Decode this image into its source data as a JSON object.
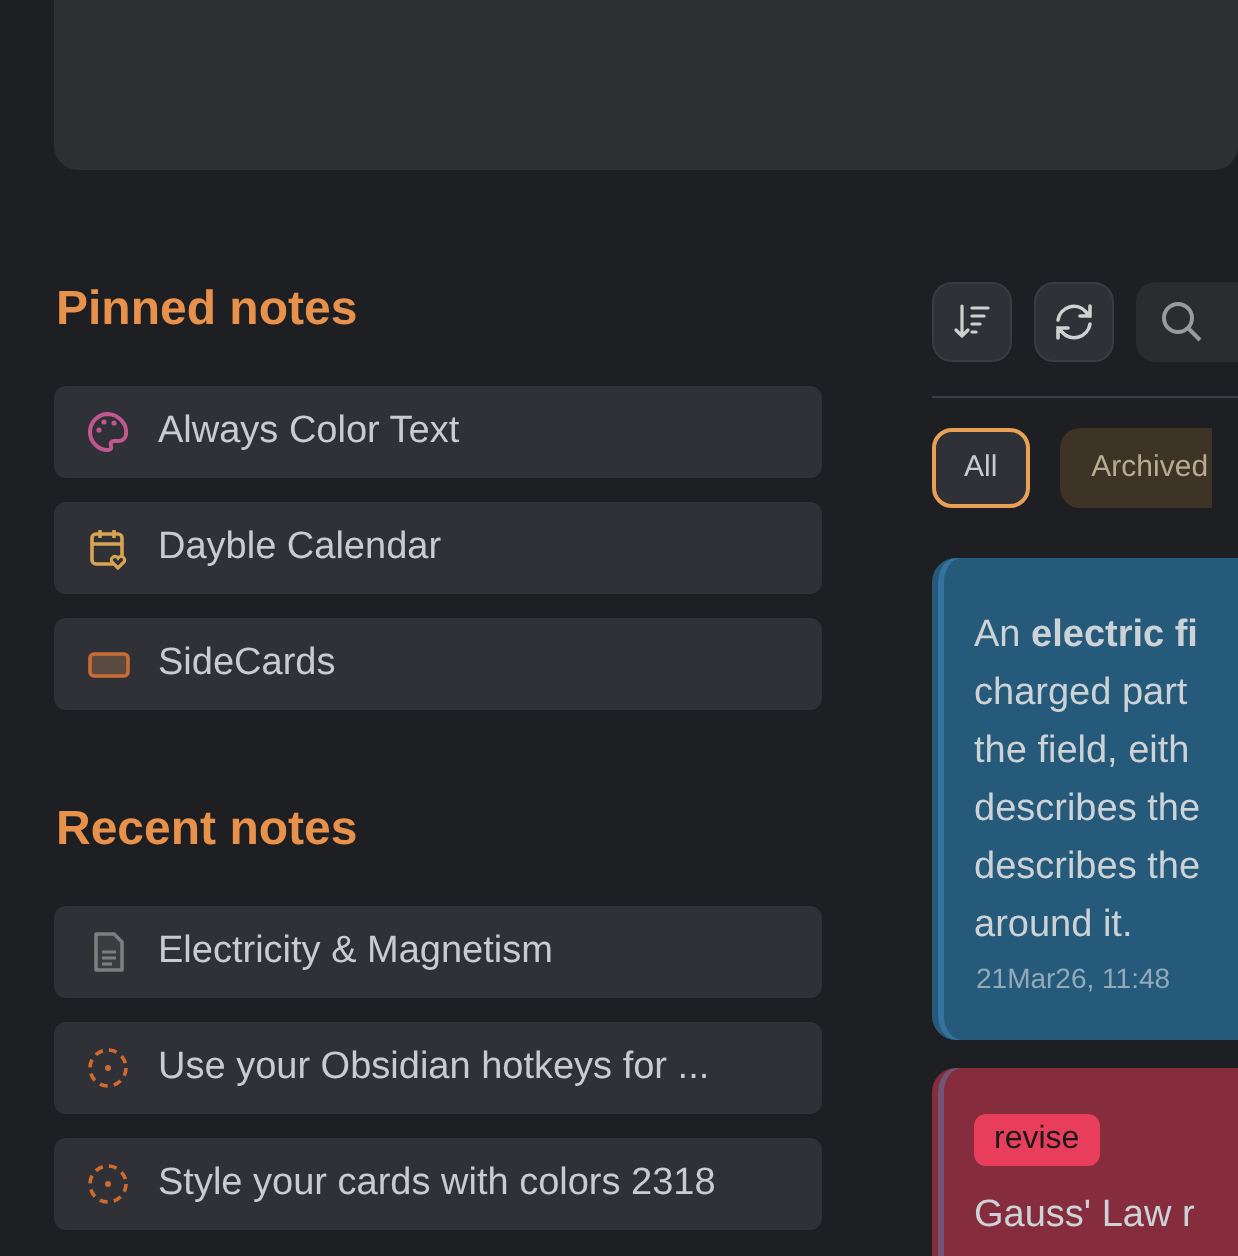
{
  "pinned": {
    "title": "Pinned notes",
    "items": [
      {
        "label": "Always Color Text",
        "kind": "palette"
      },
      {
        "label": "Dayble Calendar",
        "kind": "calendar"
      },
      {
        "label": "SideCards",
        "kind": "card"
      }
    ]
  },
  "recent": {
    "title": "Recent notes",
    "items": [
      {
        "label": "Electricity & Magnetism",
        "kind": "file"
      },
      {
        "label": "Use your Obsidian hotkeys for ...",
        "kind": "draft"
      },
      {
        "label": "Style your cards with colors 2318",
        "kind": "draft"
      }
    ]
  },
  "filters": [
    {
      "label": "All",
      "selected": true
    },
    {
      "label": "Archived",
      "selected": false
    }
  ],
  "cards": [
    {
      "color": "#265a7a",
      "lines": [
        "An **electric fi**",
        "charged part",
        "the field, eith",
        "describes the",
        "describes the",
        "around it."
      ],
      "date": "21Mar26, 11:48"
    },
    {
      "color": "#852c3d",
      "tag": "revise",
      "lines": [
        "Gauss' Law r"
      ]
    }
  ]
}
